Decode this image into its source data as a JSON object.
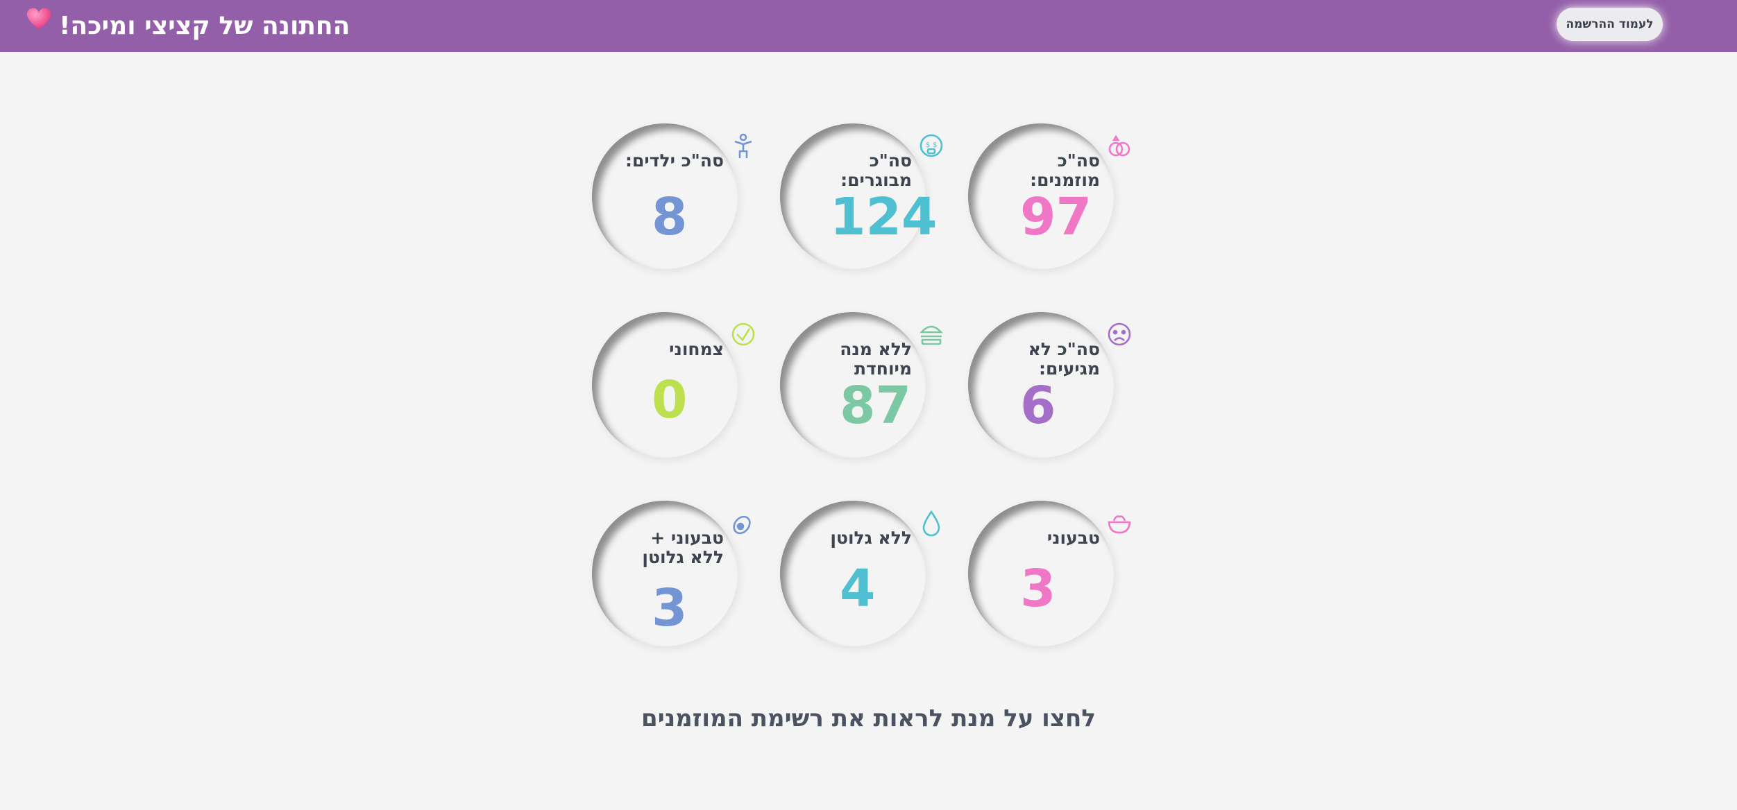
{
  "header": {
    "title": "החתונה של קציצי ומיכה!",
    "register_button": "לעמוד ההרשמה"
  },
  "stats": [
    {
      "label": "סה\"כ מוזמנים:",
      "value": "97",
      "icon": "rings-icon",
      "color": "#ef77c5"
    },
    {
      "label": "סה\"כ מבוגרים:",
      "value": "124",
      "icon": "adult-face-icon",
      "color": "#4fbfd2"
    },
    {
      "label": "סה\"כ ילדים:",
      "value": "8",
      "icon": "child-icon",
      "color": "#7395d4"
    },
    {
      "label": "סה\"כ לא מגיעים:",
      "value": "6",
      "icon": "sad-face-icon",
      "color": "#a56fc9"
    },
    {
      "label": "ללא מנה מיוחדת",
      "value": "87",
      "icon": "burger-icon",
      "color": "#7cc8a4"
    },
    {
      "label": "צמחוני",
      "value": "0",
      "icon": "vegetarian-icon",
      "color": "#bde04e"
    },
    {
      "label": "טבעוני",
      "value": "3",
      "icon": "salad-bowl-icon",
      "color": "#ef77c5"
    },
    {
      "label": "ללא גלוטן",
      "value": "4",
      "icon": "drop-icon",
      "color": "#4fbfd2"
    },
    {
      "label": "טבעוני + ללא גלוטן",
      "value": "3",
      "icon": "avocado-icon",
      "color": "#7395d4"
    }
  ],
  "footer": {
    "guest_list_link": "לחצו על מנת לראות את רשימת המוזמנים"
  },
  "colors": {
    "header_bg": "#935fa8",
    "page_bg": "#f4f4f4",
    "text_dark": "#3d4450"
  }
}
